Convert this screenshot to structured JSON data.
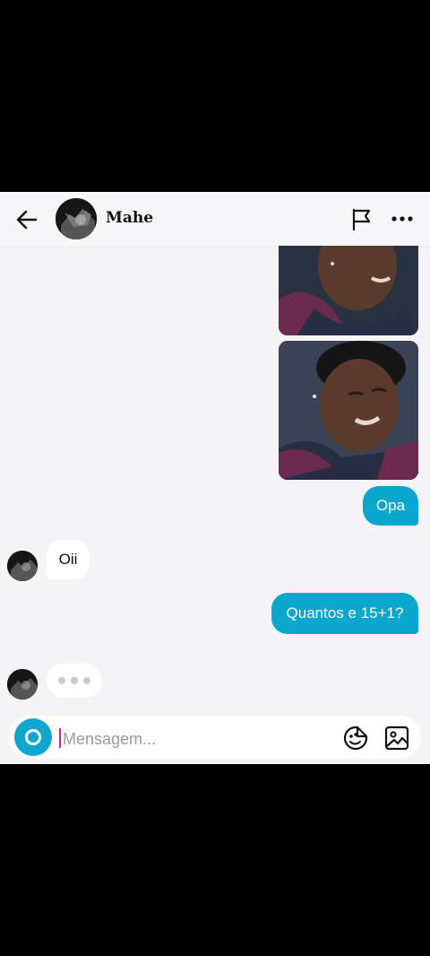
{
  "header": {
    "contact_name": "Mahe",
    "icons": [
      "back-arrow-icon",
      "contact-avatar",
      "flag-icon",
      "more-options-icon"
    ]
  },
  "messages": [
    {
      "type": "image",
      "direction": "outgoing",
      "description": "photo"
    },
    {
      "type": "image",
      "direction": "outgoing",
      "description": "photo"
    },
    {
      "type": "text",
      "direction": "outgoing",
      "text": "Opa"
    },
    {
      "type": "text",
      "direction": "incoming",
      "text": "Oii"
    },
    {
      "type": "text",
      "direction": "outgoing",
      "text": "Quantos e 15+1?"
    },
    {
      "type": "typing",
      "direction": "incoming"
    }
  ],
  "composer": {
    "placeholder": "Mensagem...",
    "icons": [
      "camera-icon",
      "sticker-icon",
      "gallery-icon"
    ]
  },
  "colors": {
    "accent": "#0aa7cc",
    "background": "#f4f4f6",
    "incoming_bubble": "#ffffff"
  }
}
